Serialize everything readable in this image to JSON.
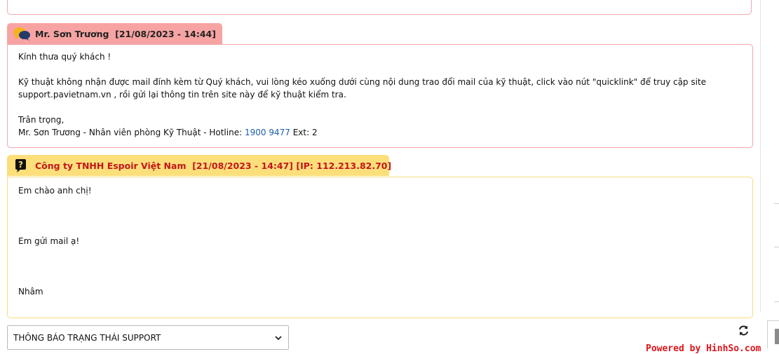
{
  "conversation": [
    {
      "role": "staff",
      "author": "Mr. Sơn Trương",
      "time": "[21/08/2023 - 14:44]",
      "body": {
        "greeting": "Kính thưa quý khách !",
        "line1": "Kỹ thuật không nhận được mail đính kèm từ Quý khách, vui lòng kéo xuống dưới cùng nội dung trao đổi mail của kỹ thuật, click vào nút \"quicklink\" để truy cập site",
        "line2": "support.pavietnam.vn , rồi gửi lại thông tin trên site này để kỹ thuật kiểm tra.",
        "closing": "Trân trọng,",
        "signature_prefix": "Mr. Sơn Trương - Nhân viên phòng Kỹ Thuật - Hotline:",
        "hotline": "1900 9477",
        "extension": "Ext: 2"
      },
      "colors": {
        "header": "#f7a3a3",
        "border": "#f0a9ae"
      }
    },
    {
      "role": "customer",
      "author": "Công ty TNHH Espoir Việt Nam",
      "time": "[21/08/2023 - 14:47]",
      "ip": "[IP: 112.213.82.70]",
      "body": {
        "line1": "Em chào anh chị!",
        "line2": "Em gửi mail ạ!",
        "line3": "Nhâm"
      },
      "colors": {
        "header": "#fcdf7b",
        "border": "#f5dc80",
        "title": "#c4161c"
      }
    }
  ],
  "status_select": {
    "selected": "THÔNG BÁO TRẠNG THÁI SUPPORT"
  },
  "icons": {
    "staff": "chat-bubbles-icon",
    "customer": "question-icon",
    "refresh": "refresh-icon",
    "dropdown": "chevron-down-icon"
  },
  "footer": {
    "powered_by": "Powered by HinhSo.com",
    "color": "#e0151b"
  }
}
